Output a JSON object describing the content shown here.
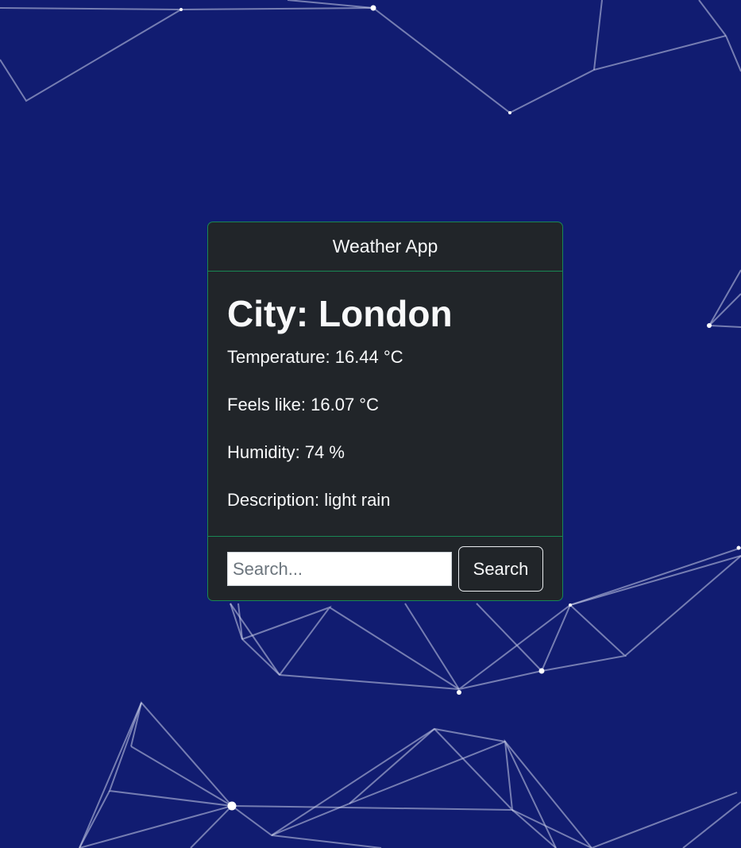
{
  "app": {
    "title": "Weather App"
  },
  "weather": {
    "city": "City: London",
    "temperature": "Temperature: 16.44 °C",
    "feels_like": "Feels like: 16.07 °C",
    "humidity": "Humidity: 74 %",
    "description": "Description: light rain"
  },
  "search": {
    "placeholder": "Search...",
    "value": "",
    "button_label": "Search"
  },
  "colors": {
    "background": "#111c71",
    "card": "#212529",
    "card_border": "#198754",
    "text": "#f8f9fa"
  }
}
